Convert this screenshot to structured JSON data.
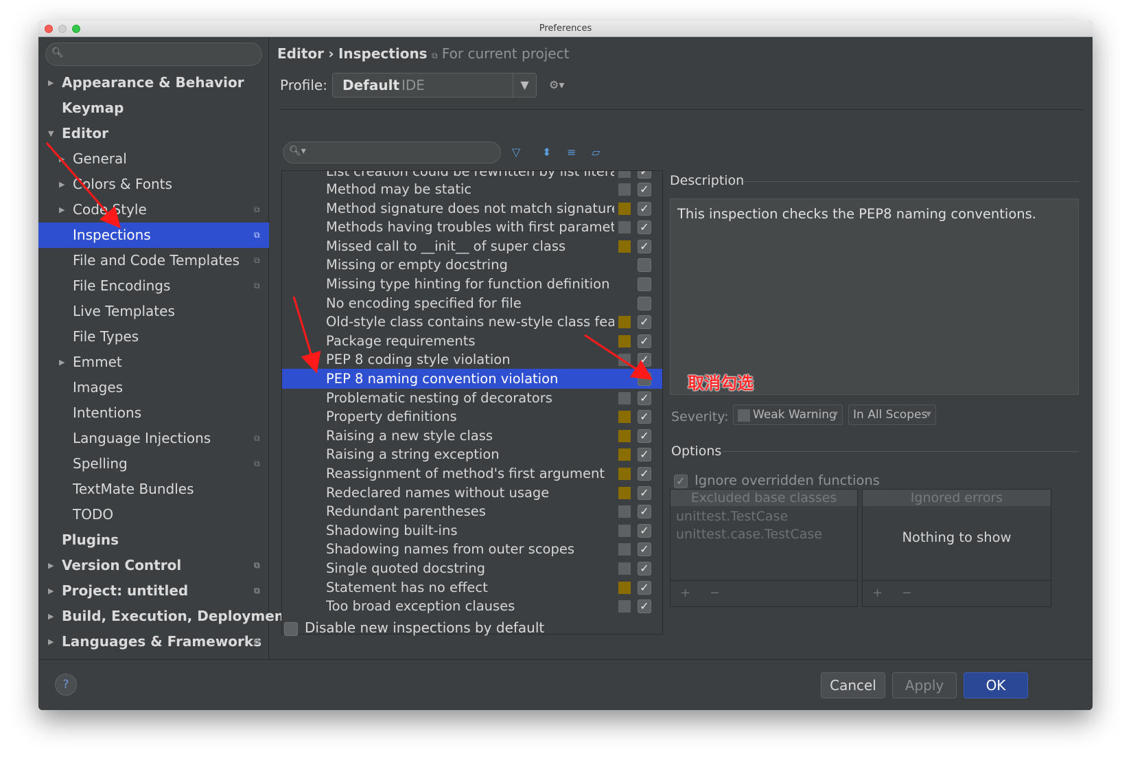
{
  "window": {
    "title": "Preferences"
  },
  "sidebar": {
    "items": [
      {
        "label": "Appearance & Behavior",
        "level": 0,
        "bold": true,
        "arrow": "▶",
        "shared": false
      },
      {
        "label": "Keymap",
        "level": 0,
        "bold": true,
        "arrow": "",
        "shared": false
      },
      {
        "label": "Editor",
        "level": 0,
        "bold": true,
        "arrow": "▼",
        "shared": false
      },
      {
        "label": "General",
        "level": 1,
        "bold": false,
        "arrow": "▶",
        "shared": false
      },
      {
        "label": "Colors & Fonts",
        "level": 1,
        "bold": false,
        "arrow": "▶",
        "shared": false
      },
      {
        "label": "Code Style",
        "level": 1,
        "bold": false,
        "arrow": "▶",
        "shared": true
      },
      {
        "label": "Inspections",
        "level": 1,
        "bold": false,
        "arrow": "",
        "shared": true,
        "selected": true
      },
      {
        "label": "File and Code Templates",
        "level": 1,
        "bold": false,
        "arrow": "",
        "shared": true
      },
      {
        "label": "File Encodings",
        "level": 1,
        "bold": false,
        "arrow": "",
        "shared": true
      },
      {
        "label": "Live Templates",
        "level": 1,
        "bold": false,
        "arrow": "",
        "shared": false
      },
      {
        "label": "File Types",
        "level": 1,
        "bold": false,
        "arrow": "",
        "shared": false
      },
      {
        "label": "Emmet",
        "level": 1,
        "bold": false,
        "arrow": "▶",
        "shared": false
      },
      {
        "label": "Images",
        "level": 1,
        "bold": false,
        "arrow": "",
        "shared": false
      },
      {
        "label": "Intentions",
        "level": 1,
        "bold": false,
        "arrow": "",
        "shared": false
      },
      {
        "label": "Language Injections",
        "level": 1,
        "bold": false,
        "arrow": "",
        "shared": true
      },
      {
        "label": "Spelling",
        "level": 1,
        "bold": false,
        "arrow": "",
        "shared": true
      },
      {
        "label": "TextMate Bundles",
        "level": 1,
        "bold": false,
        "arrow": "",
        "shared": false
      },
      {
        "label": "TODO",
        "level": 1,
        "bold": false,
        "arrow": "",
        "shared": false
      },
      {
        "label": "Plugins",
        "level": 0,
        "bold": true,
        "arrow": "",
        "shared": false
      },
      {
        "label": "Version Control",
        "level": 0,
        "bold": true,
        "arrow": "▶",
        "shared": true
      },
      {
        "label": "Project: untitled",
        "level": 0,
        "bold": true,
        "arrow": "▶",
        "shared": true
      },
      {
        "label": "Build, Execution, Deploymen",
        "level": 0,
        "bold": true,
        "arrow": "▶",
        "shared": false
      },
      {
        "label": "Languages & Frameworks",
        "level": 0,
        "bold": true,
        "arrow": "▶",
        "shared": true
      }
    ]
  },
  "breadcrumb": {
    "part1": "Editor",
    "sep": "›",
    "part2": "Inspections",
    "scope": "For current project"
  },
  "profile": {
    "label": "Profile:",
    "value": "Default",
    "kind": "IDE"
  },
  "inspections": {
    "partial_top": "List creation could be rewritten by list literal",
    "rows": [
      {
        "name": "Method may be static",
        "severity": "gray",
        "checked": true
      },
      {
        "name": "Method signature does not match signature of",
        "severity": "olive",
        "checked": true
      },
      {
        "name": "Methods having troubles with first parameter",
        "severity": "gray",
        "checked": true
      },
      {
        "name": "Missed call to __init__ of super class",
        "severity": "olive",
        "checked": true
      },
      {
        "name": "Missing or empty docstring",
        "severity": "",
        "checked": false
      },
      {
        "name": "Missing type hinting for function definition",
        "severity": "",
        "checked": false
      },
      {
        "name": "No encoding specified for file",
        "severity": "",
        "checked": false
      },
      {
        "name": "Old-style class contains new-style class feature",
        "severity": "olive",
        "checked": true
      },
      {
        "name": "Package requirements",
        "severity": "olive",
        "checked": true
      },
      {
        "name": "PEP 8 coding style violation",
        "severity": "gray",
        "checked": true
      },
      {
        "name": "PEP 8 naming convention violation",
        "severity": "",
        "checked": false,
        "selected": true
      },
      {
        "name": "Problematic nesting of decorators",
        "severity": "gray",
        "checked": true
      },
      {
        "name": "Property definitions",
        "severity": "olive",
        "checked": true
      },
      {
        "name": "Raising a new style class",
        "severity": "olive",
        "checked": true
      },
      {
        "name": "Raising a string exception",
        "severity": "olive",
        "checked": true
      },
      {
        "name": "Reassignment of method's first argument",
        "severity": "olive",
        "checked": true
      },
      {
        "name": "Redeclared names without usage",
        "severity": "olive",
        "checked": true
      },
      {
        "name": "Redundant parentheses",
        "severity": "gray",
        "checked": true
      },
      {
        "name": "Shadowing built-ins",
        "severity": "gray",
        "checked": true
      },
      {
        "name": "Shadowing names from outer scopes",
        "severity": "gray",
        "checked": true
      },
      {
        "name": "Single quoted docstring",
        "severity": "gray",
        "checked": true
      },
      {
        "name": "Statement has no effect",
        "severity": "olive",
        "checked": true
      },
      {
        "name": "Too broad exception clauses",
        "severity": "gray",
        "checked": true
      }
    ],
    "disable_new_label": "Disable new inspections by default"
  },
  "description": {
    "title": "Description",
    "text": "This inspection checks the PEP8 naming conventions."
  },
  "severity": {
    "label": "Severity:",
    "value": "Weak Warning",
    "scope": "In All Scopes"
  },
  "options": {
    "title": "Options",
    "ignore_overridden": "Ignore overridden functions",
    "excluded_header": "Excluded base classes",
    "excluded": [
      "unittest.TestCase",
      "unittest.case.TestCase"
    ],
    "ignored_header": "Ignored errors",
    "ignored_empty": "Nothing to show",
    "add": "+",
    "remove": "−"
  },
  "buttons": {
    "help": "?",
    "cancel": "Cancel",
    "apply": "Apply",
    "ok": "OK"
  },
  "annotation": {
    "text": "取消勾选",
    "color": "#ff2a2a"
  },
  "colors": {
    "selection": "#2f4fd1",
    "severity_olive": "#8a6d00",
    "severity_gray": "#5e6163"
  }
}
